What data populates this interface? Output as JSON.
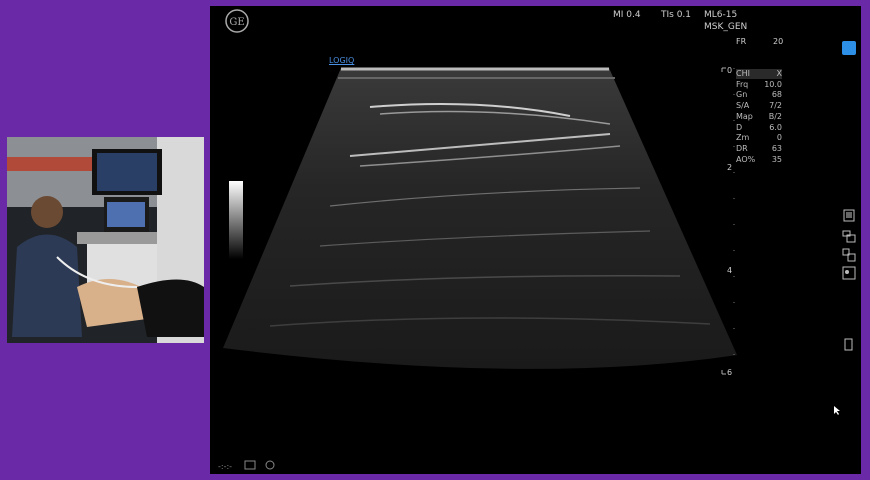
{
  "header": {
    "mi": "MI 0.4",
    "tis": "TIs 0.1",
    "probe": "ML6-15",
    "preset": "MSK_GEN",
    "fr_label": "FR",
    "fr_value": "20",
    "brand_tag": "LOGIQ"
  },
  "params": [
    {
      "key": "CHI",
      "value": "X"
    },
    {
      "key": "Frq",
      "value": "10.0"
    },
    {
      "key": "Gn",
      "value": "68"
    },
    {
      "key": "S/A",
      "value": "7/2"
    },
    {
      "key": "Map",
      "value": "B/2"
    },
    {
      "key": "D",
      "value": "6.0"
    },
    {
      "key": "Zm",
      "value": "0"
    },
    {
      "key": "DR",
      "value": "63"
    },
    {
      "key": "AO%",
      "value": "35"
    }
  ],
  "depth_scale": {
    "labels": [
      "0",
      "2",
      "4",
      "6"
    ]
  },
  "footer": {
    "left_text": "-:-:-"
  },
  "colors": {
    "border_purple": "#6a2aa8",
    "accent_blue": "#2e8fe6"
  }
}
